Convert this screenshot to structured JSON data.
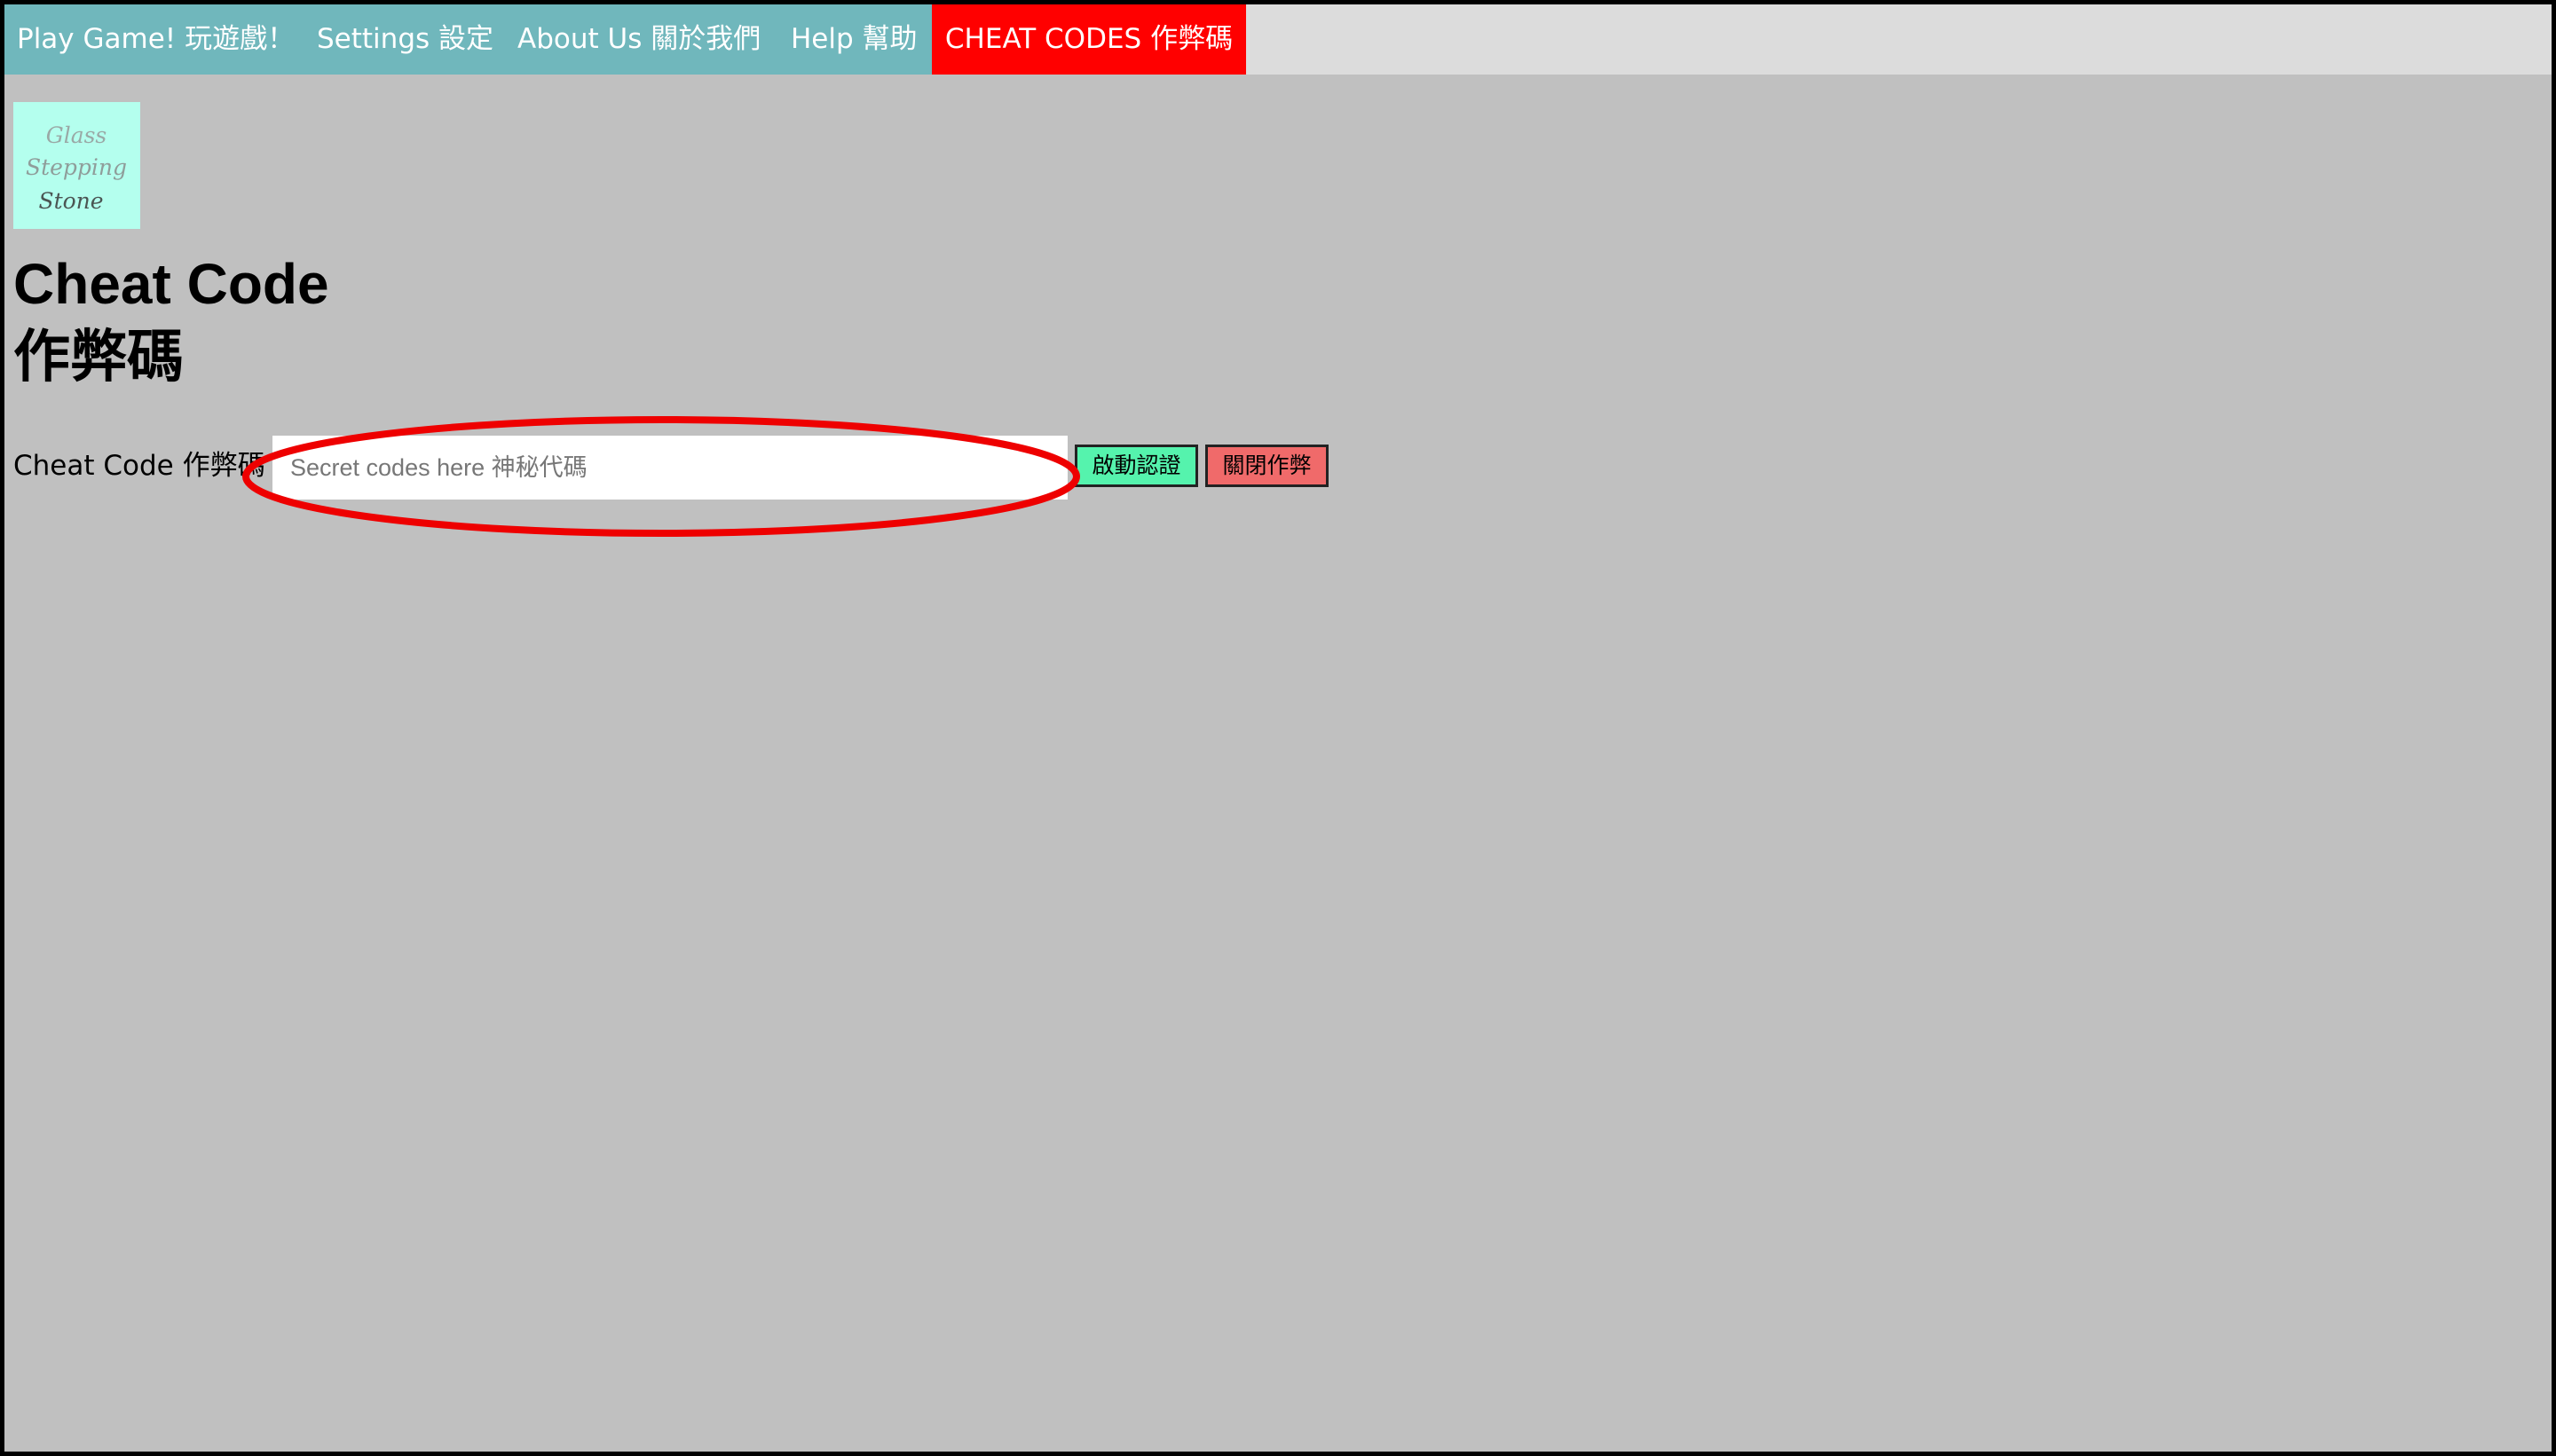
{
  "nav": {
    "play": "Play Game! 玩遊戲！",
    "settings": "Settings 設定",
    "about": "About Us 關於我們",
    "help": "Help 幫助",
    "cheat": "CHEAT CODES 作弊碼"
  },
  "logo": {
    "lines": [
      "Glass",
      "Stepping",
      "Stone"
    ]
  },
  "title": {
    "line1": "Cheat Code",
    "line2": "作弊碼"
  },
  "form": {
    "label": "Cheat Code 作弊碼 :",
    "input_value": "",
    "input_placeholder": "Secret codes here 神秘代碼",
    "activate_label": "啟動認證",
    "disable_label": "關閉作弊"
  },
  "colors": {
    "nav_teal": "#70b7bc",
    "nav_active": "#ff0000",
    "page_bg": "#c0c0c0",
    "logo_bg": "#b4ffee",
    "activate_btn": "#55f3ad",
    "disable_btn": "#f06a6a",
    "annotation": "#ee0000"
  }
}
